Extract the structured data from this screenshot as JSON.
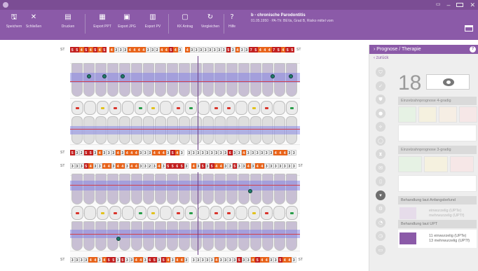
{
  "toolbar": {
    "buttons": [
      {
        "id": "save",
        "label": "Speichern",
        "icon": "save-icon"
      },
      {
        "id": "close",
        "label": "Schließen",
        "icon": "close-icon"
      },
      {
        "id": "print",
        "label": "Drucken",
        "icon": "printer-icon"
      },
      {
        "id": "ppt",
        "label": "Export PPT",
        "icon": "powerpoint-icon"
      },
      {
        "id": "jpg",
        "label": "Export JPG",
        "icon": "image-export-icon"
      },
      {
        "id": "pv",
        "label": "Export PV",
        "icon": "file-export-icon"
      },
      {
        "id": "kk",
        "label": "KK Antrag",
        "icon": "document-icon"
      },
      {
        "id": "compare",
        "label": "Vergleichen",
        "icon": "refresh-icon"
      },
      {
        "id": "help",
        "label": "Hilfe",
        "icon": "help-icon"
      }
    ],
    "diagnosis_title": "b - chronische Parodontitis",
    "patient_info": "01.05.1950 · PA-Th: BEVa, Grad B, Risiko mittel vom"
  },
  "chart": {
    "st_label": "ST",
    "upper_st_top": [
      "5",
      "5",
      "4",
      "5",
      "4",
      "5",
      "4",
      "5",
      "",
      "4",
      "3",
      "3",
      "3",
      "4",
      "4",
      "4",
      "4",
      "3",
      "3",
      "2",
      "4",
      "4",
      "5",
      "4",
      "3",
      "",
      "4",
      "3",
      "3",
      "3",
      "3",
      "3",
      "3",
      "3",
      "3",
      "5",
      "3",
      "4",
      "3",
      "3",
      "7",
      "5",
      "4",
      "4",
      "4",
      "7",
      "5",
      "4",
      "5",
      "5"
    ],
    "upper_st_bottom": [
      "5",
      "3",
      "2",
      "5",
      "5",
      "3",
      "4",
      "3",
      "3",
      "3",
      "4",
      "3",
      "4",
      "4",
      "4",
      "3",
      "3",
      "3",
      "4",
      "4",
      "4",
      "3",
      "5",
      "4",
      "3",
      "",
      "3",
      "3",
      "3",
      "3",
      "3",
      "3",
      "3",
      "3",
      "3",
      "6",
      "3",
      "3",
      "4",
      "3",
      "3",
      "3",
      "3",
      "3",
      "3",
      "4",
      "4",
      "4",
      "3",
      "3"
    ],
    "lower_st_top": [
      "3",
      "3",
      "3",
      "5",
      "4",
      "3",
      "3",
      "4",
      "4",
      "3",
      "4",
      "4",
      "3",
      "4",
      "4",
      "3",
      "3",
      "2",
      "3",
      "4",
      "3",
      "5",
      "5",
      "6",
      "5",
      "3",
      "",
      "4",
      "3",
      "5",
      "3",
      "5",
      "4",
      "4",
      "3",
      "3",
      "5",
      "3",
      "3",
      "4",
      "3",
      "4",
      "4",
      "3",
      "3",
      "3",
      "3",
      "3",
      "3",
      "3"
    ],
    "lower_st_bottom": [
      "3",
      "3",
      "3",
      "3",
      "4",
      "4",
      "3",
      "4",
      "5",
      "5",
      "3",
      "5",
      "3",
      "3",
      "4",
      "4",
      "3",
      "6",
      "5",
      "3",
      "5",
      "4",
      "3",
      "4",
      "4",
      "3",
      "",
      "3",
      "3",
      "3",
      "3",
      "3",
      "4",
      "3",
      "3",
      "3",
      "3",
      "5",
      "3",
      "3",
      "4",
      "5",
      "4",
      "4",
      "3",
      "3",
      "5",
      "4",
      "4",
      "3"
    ]
  },
  "panel": {
    "header": "Prognose / Therapie",
    "back": "zurück",
    "count": "18",
    "sec_prog4": "Einzelzahnprognose 4-gradig",
    "sec_prog3": "Einzelzahnprognose 3-gradig",
    "sec_anfang": "Behandlung laut Anfangsbefund",
    "anfang_line1": "einwurzelig (UPTe)",
    "anfang_line2": "mehrwurzelig (UPTf)",
    "sec_upt": "Behandlung laut UPT",
    "upt_line1": "11 einwurzelig (UPTe)",
    "upt_line2": "13 mehrwurzelig (UPTf)",
    "help": "?",
    "colors": {
      "accent": "#8b5aa8",
      "upt_swatch": "#8b5aa8",
      "anfang_swatch": "#e6dcea"
    }
  }
}
